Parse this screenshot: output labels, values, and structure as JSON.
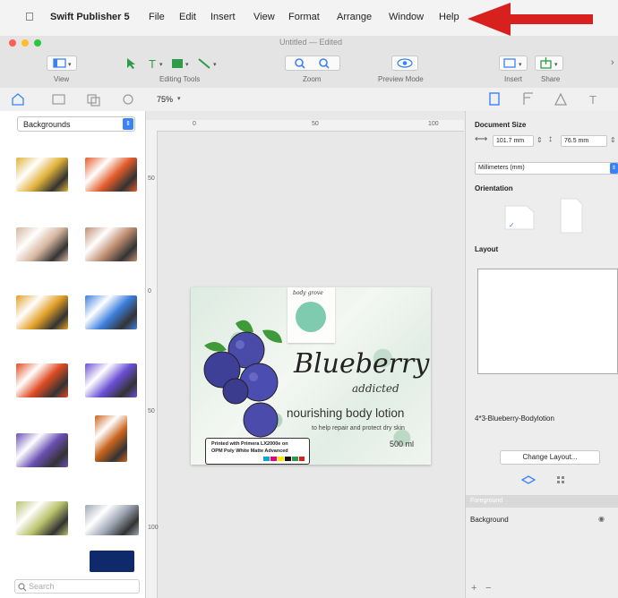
{
  "menubar": {
    "app_name": "Swift Publisher 5",
    "items": [
      "File",
      "Edit",
      "Insert",
      "View",
      "Format",
      "Arrange",
      "Window",
      "Help"
    ]
  },
  "window": {
    "title": "Untitled — Edited"
  },
  "toolbar": {
    "labels": {
      "view": "View",
      "editing_tools": "Editing Tools",
      "zoom": "Zoom",
      "preview": "Preview Mode",
      "insert": "Insert",
      "share": "Share"
    }
  },
  "subbar": {
    "zoom_value": "75%"
  },
  "sidebar": {
    "category": "Backgrounds",
    "search_placeholder": "Search",
    "thumb_colors": [
      [
        "#e0b23a",
        "#e35c2a"
      ],
      [
        "#d6b69f",
        "#c08e71"
      ],
      [
        "#e2a028",
        "#3d7fdd"
      ],
      [
        "#df4b22",
        "#6b4fd6"
      ],
      [
        "#6a4fb3",
        "#c9631c"
      ],
      [
        "#b9c36d",
        "#9fa7b5"
      ]
    ],
    "extra_thumb_color": "#0f2a6a"
  },
  "ruler": {
    "h_ticks": [
      "0",
      "50",
      "100"
    ],
    "v_ticks": [
      "50",
      "0",
      "50",
      "100"
    ]
  },
  "label_design": {
    "logo_text": "body grove",
    "title": "Blueberry",
    "script": "addicted",
    "product": "nourishing body lotion",
    "tagline": "to help repair and protect dry skin",
    "volume": "500 ml",
    "print_note_line1": "Printed with Primera LX2000e on",
    "print_note_line2": "OPM Poly White Matte Advanced"
  },
  "inspector": {
    "document_size_label": "Document Size",
    "width_value": "101.7 mm",
    "height_value": "76.5 mm",
    "units": "Millimeters (mm)",
    "orientation_label": "Orientation",
    "layout_label": "Layout",
    "layout_name": "4*3-Blueberry-Bodylotion",
    "change_layout": "Change Layout...",
    "layers_header": "Foreground",
    "layer_background": "Background"
  },
  "colors": {
    "accent": "#3b82f6",
    "arrow": "#d8201f"
  }
}
